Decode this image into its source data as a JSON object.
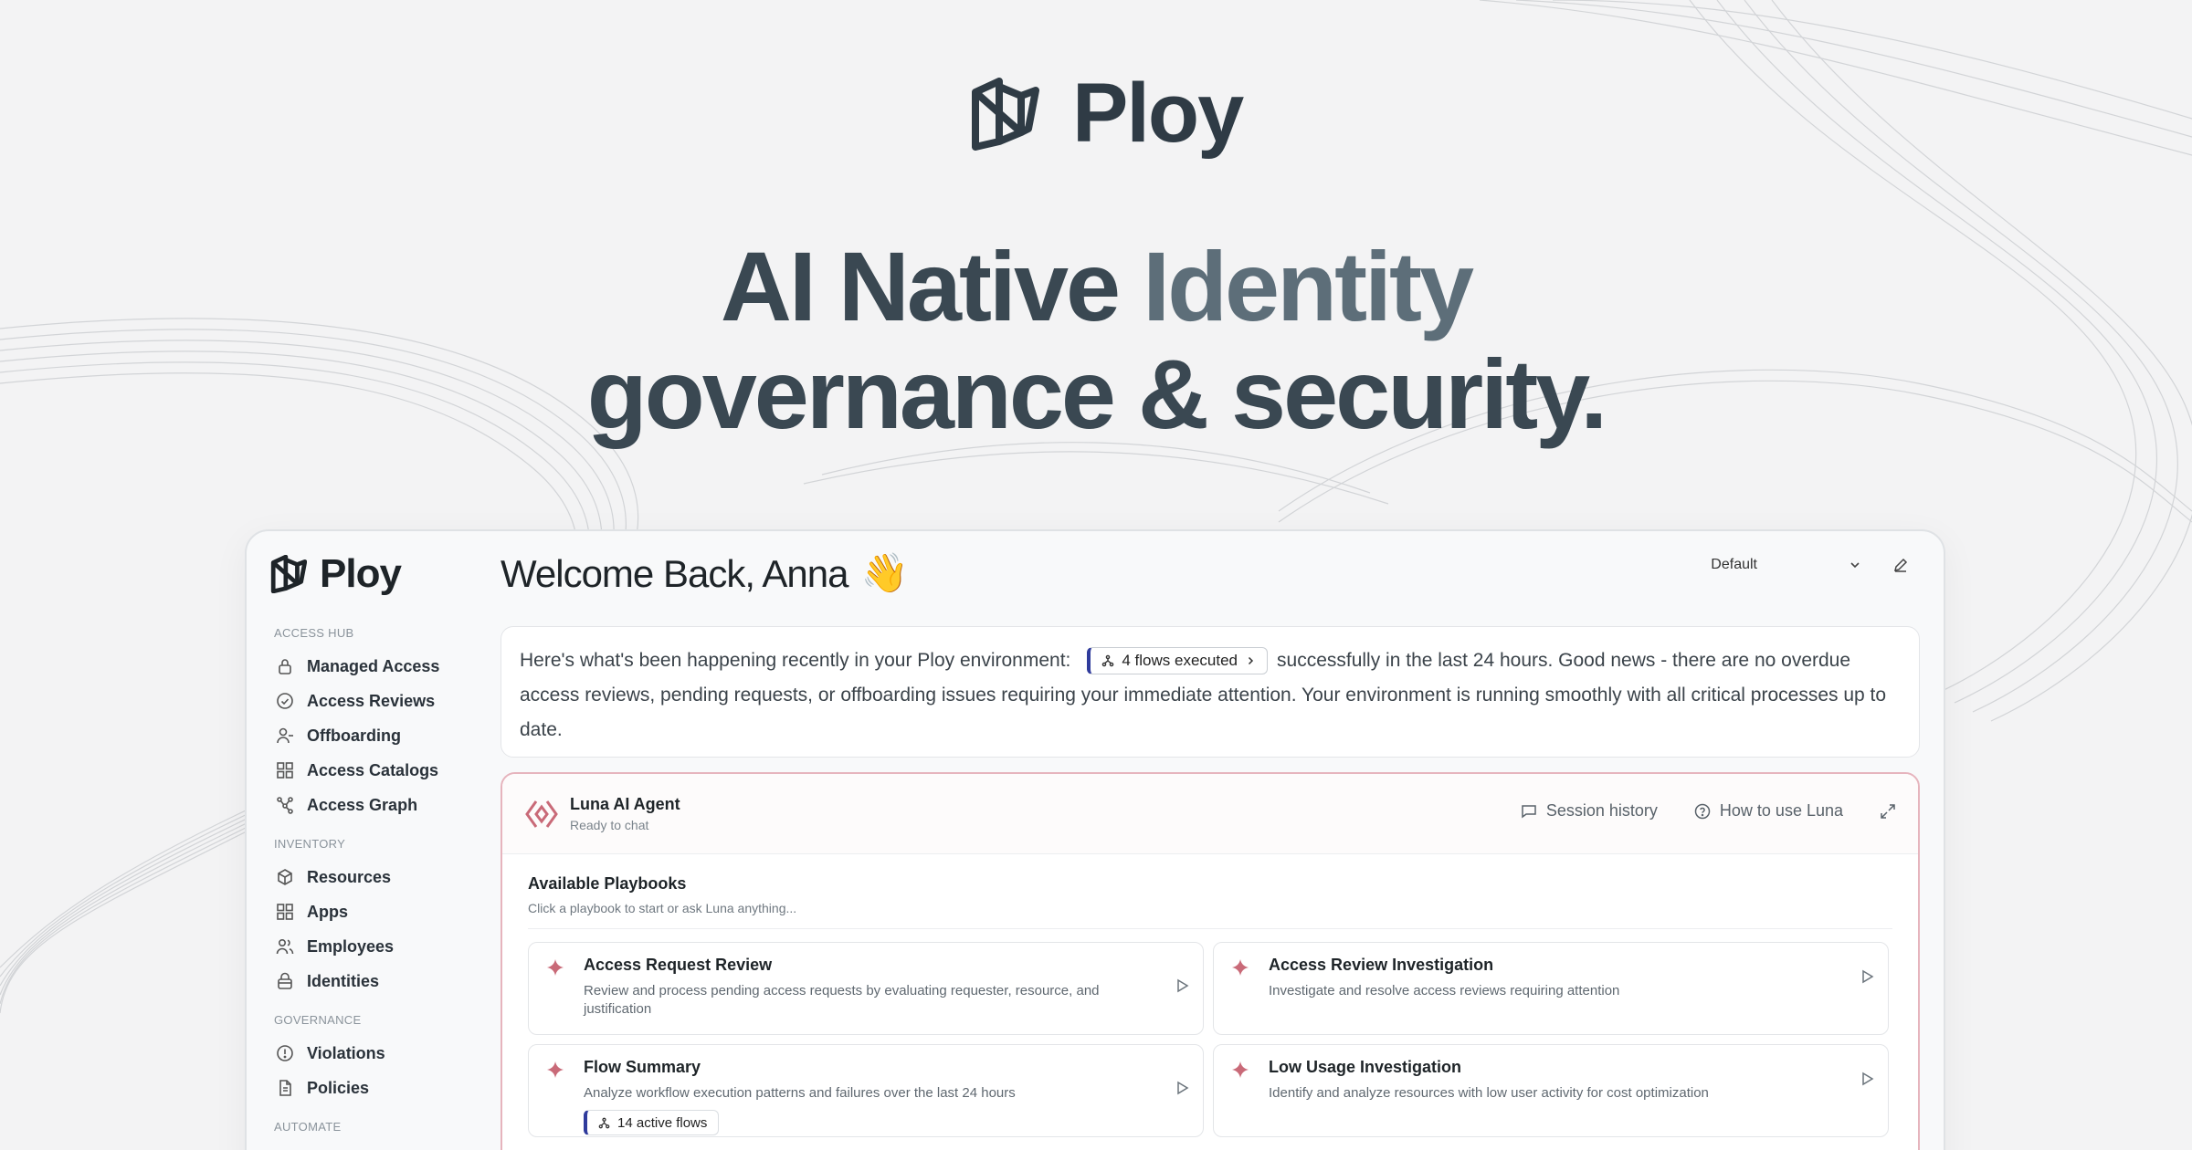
{
  "hero": {
    "brand": "Ploy",
    "title_line1_a": "AI Native ",
    "title_line1_b": "Identity",
    "title_line2": "governance & security."
  },
  "app": {
    "brand": "Ploy",
    "sidebar": {
      "sections": [
        {
          "label": "ACCESS HUB",
          "items": [
            {
              "label": "Managed Access",
              "icon": "lock-icon"
            },
            {
              "label": "Access Reviews",
              "icon": "check-circle-icon"
            },
            {
              "label": "Offboarding",
              "icon": "user-minus-icon"
            },
            {
              "label": "Access Catalogs",
              "icon": "grid-icon"
            },
            {
              "label": "Access Graph",
              "icon": "graph-icon"
            }
          ]
        },
        {
          "label": "INVENTORY",
          "items": [
            {
              "label": "Resources",
              "icon": "cube-icon"
            },
            {
              "label": "Apps",
              "icon": "apps-grid-icon"
            },
            {
              "label": "Employees",
              "icon": "users-icon"
            },
            {
              "label": "Identities",
              "icon": "lock-card-icon"
            }
          ]
        },
        {
          "label": "GOVERNANCE",
          "items": [
            {
              "label": "Violations",
              "icon": "alert-circle-icon"
            },
            {
              "label": "Policies",
              "icon": "document-icon"
            }
          ]
        },
        {
          "label": "AUTOMATE",
          "items": []
        }
      ]
    },
    "welcome": "Welcome Back, Anna",
    "welcome_emoji": "👋",
    "view_select": "Default",
    "summary": {
      "before": "Here's what's been happening recently in your Ploy environment:",
      "chip": "4 flows executed",
      "after": "successfully in the last 24 hours. Good news - there are no overdue access reviews, pending requests, or offboarding issues requiring your immediate attention. Your environment is running smoothly with all critical processes up to date."
    },
    "luna": {
      "name": "Luna AI Agent",
      "status": "Ready to chat",
      "session_history": "Session history",
      "how_to": "How to use Luna",
      "playbooks_title": "Available Playbooks",
      "playbooks_sub": "Click a playbook to start or ask Luna anything...",
      "playbooks": [
        {
          "name": "Access Request Review",
          "desc": "Review and process pending access requests by evaluating requester, resource, and justification"
        },
        {
          "name": "Access Review Investigation",
          "desc": "Investigate and resolve access reviews requiring attention"
        },
        {
          "name": "Flow Summary",
          "desc": "Analyze workflow execution patterns and failures over the last 24 hours",
          "chip": "14 active flows"
        },
        {
          "name": "Low Usage Investigation",
          "desc": "Identify and analyze resources with low user activity for cost optimization"
        }
      ]
    }
  },
  "colors": {
    "accent": "#2f3b9c",
    "luna_border": "#e6b4bd",
    "spark": "#c96a78"
  }
}
